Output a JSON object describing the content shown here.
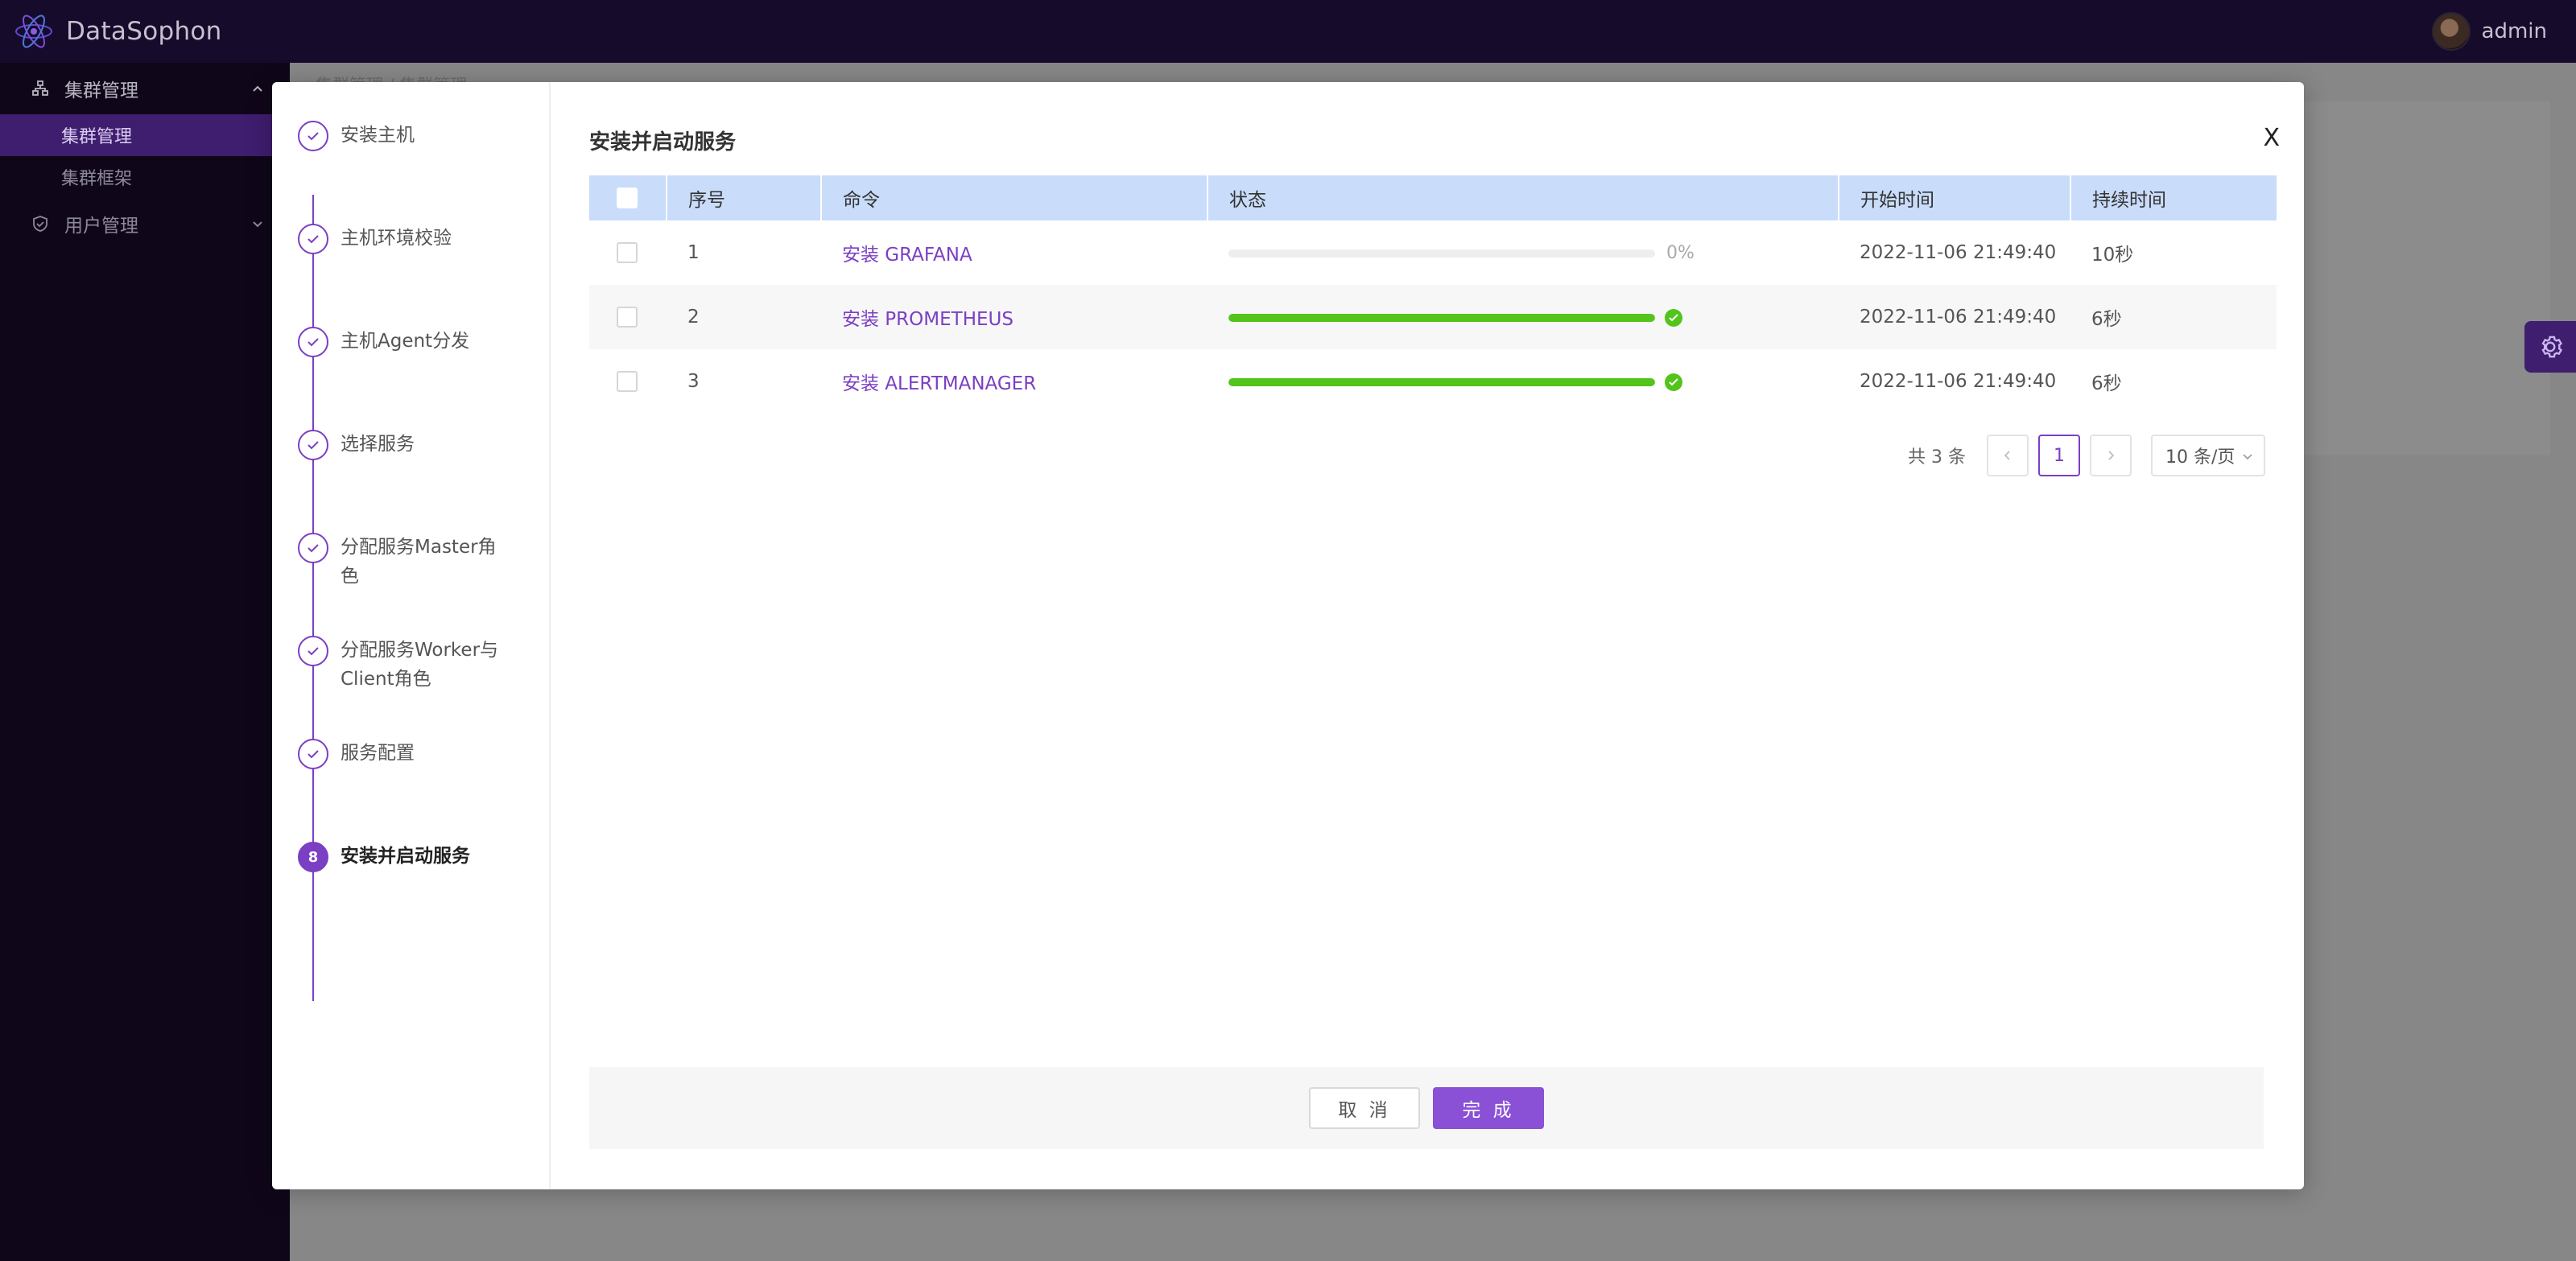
{
  "app": {
    "name": "DataSophon",
    "logo_icon": "atom-logo-icon",
    "user": "admin"
  },
  "sidebar": {
    "groups": [
      {
        "label": "集群管理",
        "icon": "cluster-icon",
        "expanded": true,
        "items": [
          {
            "label": "集群管理",
            "active": true
          },
          {
            "label": "集群框架",
            "active": false
          }
        ]
      },
      {
        "label": "用户管理",
        "icon": "shield-icon",
        "expanded": false
      }
    ]
  },
  "background": {
    "breadcrumb": "集群管理 / 集群管理"
  },
  "wizard": {
    "steps": [
      {
        "label": "安装主机",
        "status": "done"
      },
      {
        "label": "主机环境校验",
        "status": "done"
      },
      {
        "label": "主机Agent分发",
        "status": "done"
      },
      {
        "label": "选择服务",
        "status": "done"
      },
      {
        "label": "分配服务Master角色",
        "status": "done"
      },
      {
        "label": "分配服务Worker与Client角色",
        "status": "done"
      },
      {
        "label": "服务配置",
        "status": "done"
      },
      {
        "label": "安装并启动服务",
        "status": "current",
        "number": "8"
      }
    ]
  },
  "dialog": {
    "title": "安装并启动服务",
    "close_label": "X",
    "columns": [
      "序号",
      "命令",
      "状态",
      "开始时间",
      "持续时间"
    ],
    "rows": [
      {
        "index": "1",
        "command": "安装 GRAFANA",
        "progress": 0,
        "progress_text": "0%",
        "done": false,
        "start": "2022-11-06 21:49:40",
        "duration": "10秒"
      },
      {
        "index": "2",
        "command": "安装 PROMETHEUS",
        "progress": 100,
        "progress_text": "",
        "done": true,
        "start": "2022-11-06 21:49:40",
        "duration": "6秒"
      },
      {
        "index": "3",
        "command": "安装 ALERTMANAGER",
        "progress": 100,
        "progress_text": "",
        "done": true,
        "start": "2022-11-06 21:49:40",
        "duration": "6秒"
      }
    ],
    "pagination": {
      "total": "共 3 条",
      "current_page": "1",
      "page_size": "10 条/页"
    },
    "cancel_label": "取 消",
    "done_label": "完 成"
  },
  "colors": {
    "accent": "#7b3fc4",
    "success": "#52c41a",
    "header_bg": "#170b2c",
    "table_header": "#c9dcfa"
  }
}
